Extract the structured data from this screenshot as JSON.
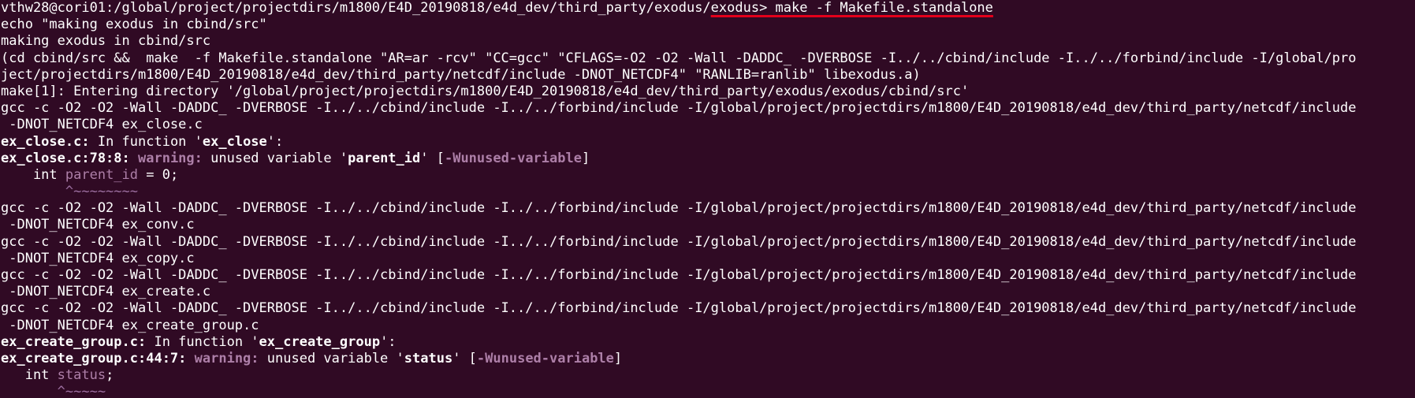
{
  "terminal": {
    "prompt": "vthw28@cori01:/global/project/projectdirs/m1800/E4D_20190818/e4d_dev/third_party/exodus/",
    "prompt_highlight": "exodus> make -f Makefile.standalone",
    "lines": [
      "echo \"making exodus in cbind/src\"",
      "making exodus in cbind/src",
      "(cd cbind/src &&  make  -f Makefile.standalone \"AR=ar -rcv\" \"CC=gcc\" \"CFLAGS=-O2 -O2 -Wall -DADDC_ -DVERBOSE -I../../cbind/include -I../../forbind/include -I/global/pro",
      "ject/projectdirs/m1800/E4D_20190818/e4d_dev/third_party/netcdf/include -DNOT_NETCDF4\" \"RANLIB=ranlib\" libexodus.a)",
      "make[1]: Entering directory '/global/project/projectdirs/m1800/E4D_20190818/e4d_dev/third_party/exodus/exodus/cbind/src'",
      "gcc -c -O2 -O2 -Wall -DADDC_ -DVERBOSE -I../../cbind/include -I../../forbind/include -I/global/project/projectdirs/m1800/E4D_20190818/e4d_dev/third_party/netcdf/include",
      " -DNOT_NETCDF4 ex_close.c"
    ],
    "warn1": {
      "func_prefix": "ex_close.c:",
      "func_text": " In function '",
      "func_name": "ex_close",
      "func_suffix": "':",
      "loc": "ex_close.c:78:8:",
      "warning": " warning:",
      "msg_a": " unused variable '",
      "msg_var": "parent_id",
      "msg_b": "' [",
      "flag": "-Wunused-variable",
      "msg_c": "]",
      "code_pre": "    int ",
      "code_var": "parent_id",
      "code_post": " = 0;",
      "caret": "        ^~~~~~~~~"
    },
    "lines2": [
      "gcc -c -O2 -O2 -Wall -DADDC_ -DVERBOSE -I../../cbind/include -I../../forbind/include -I/global/project/projectdirs/m1800/E4D_20190818/e4d_dev/third_party/netcdf/include",
      " -DNOT_NETCDF4 ex_conv.c",
      "gcc -c -O2 -O2 -Wall -DADDC_ -DVERBOSE -I../../cbind/include -I../../forbind/include -I/global/project/projectdirs/m1800/E4D_20190818/e4d_dev/third_party/netcdf/include",
      " -DNOT_NETCDF4 ex_copy.c",
      "gcc -c -O2 -O2 -Wall -DADDC_ -DVERBOSE -I../../cbind/include -I../../forbind/include -I/global/project/projectdirs/m1800/E4D_20190818/e4d_dev/third_party/netcdf/include",
      " -DNOT_NETCDF4 ex_create.c",
      "gcc -c -O2 -O2 -Wall -DADDC_ -DVERBOSE -I../../cbind/include -I../../forbind/include -I/global/project/projectdirs/m1800/E4D_20190818/e4d_dev/third_party/netcdf/include",
      " -DNOT_NETCDF4 ex_create_group.c"
    ],
    "warn2": {
      "func_prefix": "ex_create_group.c:",
      "func_text": " In function '",
      "func_name": "ex_create_group",
      "func_suffix": "':",
      "loc": "ex_create_group.c:44:7:",
      "warning": " warning:",
      "msg_a": " unused variable '",
      "msg_var": "status",
      "msg_b": "' [",
      "flag": "-Wunused-variable",
      "msg_c": "]",
      "code_pre": "   int ",
      "code_var": "status",
      "code_post": ";",
      "caret": "       ^~~~~~"
    }
  },
  "colors": {
    "background": "#300a24",
    "text": "#ffffff",
    "warning": "#ad7fa8",
    "underline": "#e3001b"
  }
}
